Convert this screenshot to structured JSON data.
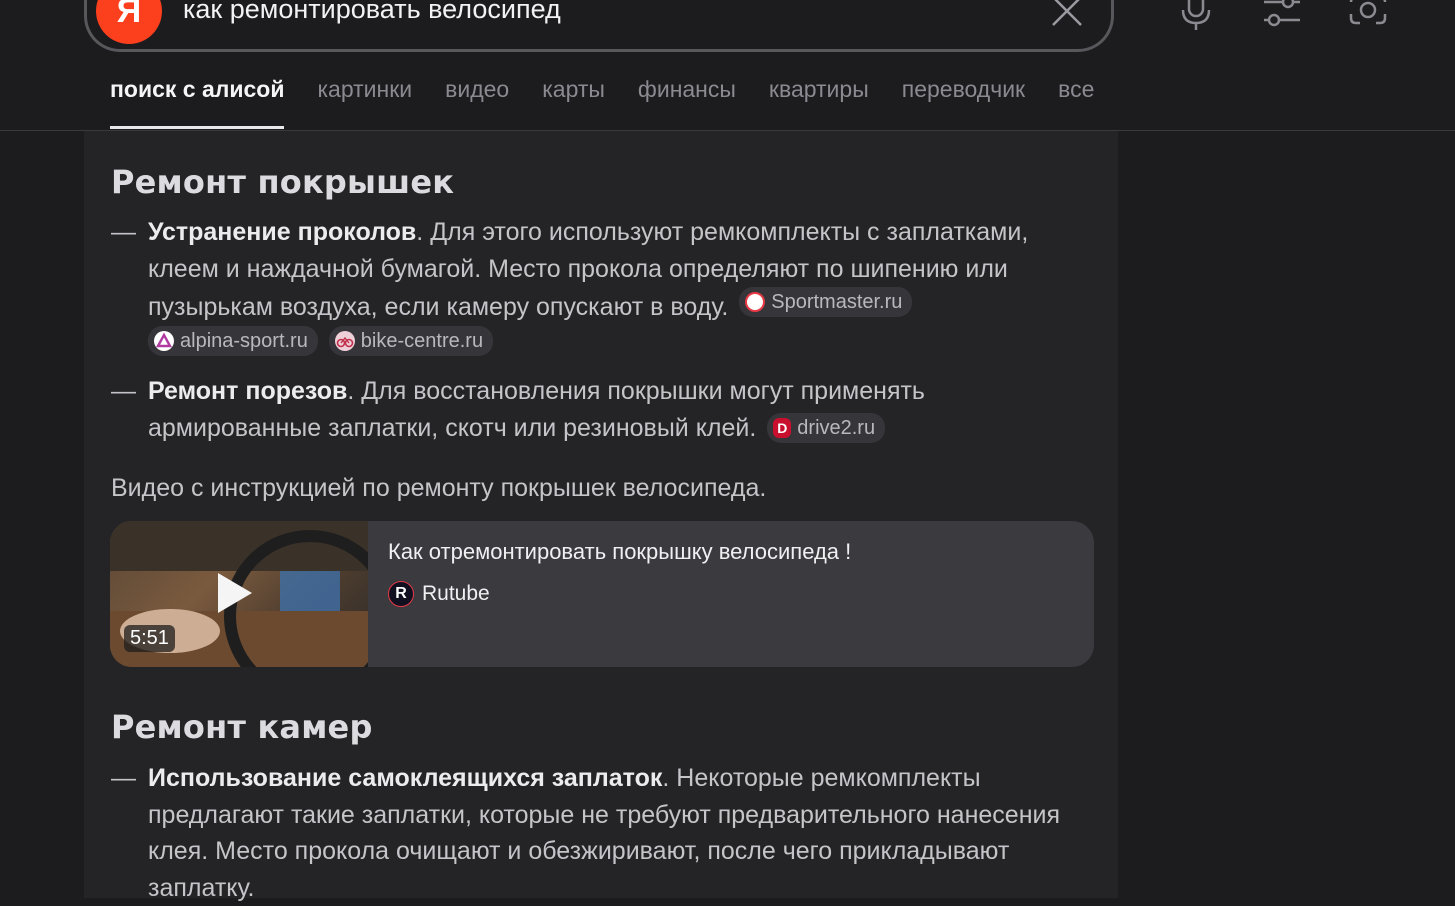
{
  "search": {
    "logo_letter": "Я",
    "query": "как ремонтировать велосипед"
  },
  "tabs": [
    {
      "label": "поиск с алисой",
      "active": true
    },
    {
      "label": "картинки"
    },
    {
      "label": "видео"
    },
    {
      "label": "карты"
    },
    {
      "label": "финансы"
    },
    {
      "label": "квартиры"
    },
    {
      "label": "переводчик"
    },
    {
      "label": "все"
    }
  ],
  "sections": [
    {
      "title": "Ремонт покрышек",
      "items": [
        {
          "bold": "Устранение проколов",
          "text": ". Для этого используют ремкомплекты с заплатками, клеем и наждачной бумагой. Место прокола определяют по шипению или пузырькам воздуха, если камеру опускают в воду.",
          "sources": [
            "Sportmaster.ru",
            "alpina-sport.ru",
            "bike-centre.ru"
          ]
        },
        {
          "bold": "Ремонт порезов",
          "text": ". Для восстановления покрышки могут применять армированные заплатки, скотч или резиновый клей.",
          "sources": [
            "drive2.ru"
          ]
        }
      ]
    },
    {
      "title": "Ремонт камер",
      "items": [
        {
          "bold": "Использование самоклеящихся заплаток",
          "text": ". Некоторые ремкомплекты предлагают такие заплатки, которые не требуют предварительного нанесения клея. Место прокола очищают и обезжиривают, после чего прикладывают заплатку."
        }
      ]
    }
  ],
  "video_intro": "Видео с инструкцией по ремонту покрышек велосипеда.",
  "video": {
    "title": "Как отремонтировать покрышку велосипеда !",
    "source": "Rutube",
    "source_logo": "R",
    "duration": "5:51"
  },
  "colors": {
    "background": "#1c1c1f",
    "panel": "#242427",
    "brand": "#fc3f1d"
  }
}
